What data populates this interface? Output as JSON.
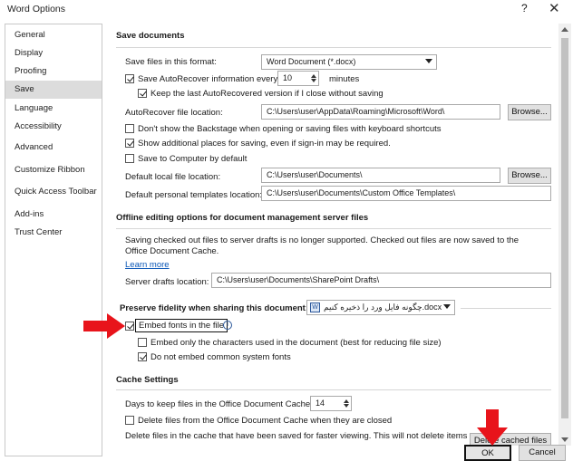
{
  "window": {
    "title": "Word Options",
    "help": "?",
    "close": "✕"
  },
  "sidebar": {
    "items": [
      {
        "label": "General"
      },
      {
        "label": "Display"
      },
      {
        "label": "Proofing"
      },
      {
        "label": "Save"
      },
      {
        "label": "Language"
      },
      {
        "label": "Accessibility"
      },
      {
        "label": "Advanced"
      },
      {
        "label": "Customize Ribbon"
      },
      {
        "label": "Quick Access Toolbar"
      },
      {
        "label": "Add-ins"
      },
      {
        "label": "Trust Center"
      }
    ],
    "selected": "Save"
  },
  "save_documents": {
    "heading": "Save documents",
    "format_label": "Save files in this format:",
    "format_value": "Word Document (*.docx)",
    "autorecover_label": "Save AutoRecover information every",
    "autorecover_checked": true,
    "autorecover_minutes": "10",
    "minutes_label": "minutes",
    "keep_last_label": "Keep the last AutoRecovered version if I close without saving",
    "keep_last_checked": true,
    "autorecover_location_label": "AutoRecover file location:",
    "autorecover_location_value": "C:\\Users\\user\\AppData\\Roaming\\Microsoft\\Word\\",
    "browse_label": "Browse...",
    "backstage_label": "Don't show the Backstage when opening or saving files with keyboard shortcuts",
    "backstage_checked": false,
    "additional_places_label": "Show additional places for saving, even if sign-in may be required.",
    "additional_places_checked": true,
    "save_to_computer_label": "Save to Computer by default",
    "save_to_computer_checked": false,
    "default_local_label": "Default local file location:",
    "default_local_value": "C:\\Users\\user\\Documents\\",
    "default_templates_label": "Default personal templates location:",
    "default_templates_value": "C:\\Users\\user\\Documents\\Custom Office Templates\\"
  },
  "offline_editing": {
    "heading": "Offline editing options for document management server files",
    "description": "Saving checked out files to server drafts is no longer supported. Checked out files are now saved to the Office Document Cache.",
    "learn_more": "Learn more",
    "server_drafts_label": "Server drafts location:",
    "server_drafts_value": "C:\\Users\\user\\Documents\\SharePoint Drafts\\"
  },
  "fidelity": {
    "heading": "Preserve fidelity when sharing this document:",
    "document_value": "چگونه فایل ورد را ذخیره کنیم.docx",
    "embed_fonts_label": "Embed fonts in the file",
    "embed_fonts_checked": true,
    "info_icon": "i",
    "embed_only_label": "Embed only the characters used in the document (best for reducing file size)",
    "embed_only_checked": false,
    "do_not_embed_label": "Do not embed common system fonts",
    "do_not_embed_checked": true
  },
  "cache": {
    "heading": "Cache Settings",
    "days_label": "Days to keep files in the Office Document Cache:",
    "days_value": "14",
    "delete_closed_label": "Delete files from the Office Document Cache when they are closed",
    "delete_closed_checked": false,
    "delete_info": "Delete files in the cache that have been saved for faster viewing. This will not delete items",
    "delete_button": "Delete cached files"
  },
  "footer": {
    "ok": "OK",
    "cancel": "Cancel"
  },
  "colors": {
    "annotation_red": "#e8141b",
    "link_blue": "#0b57b7",
    "selected_nav": "#dcdcdc"
  }
}
